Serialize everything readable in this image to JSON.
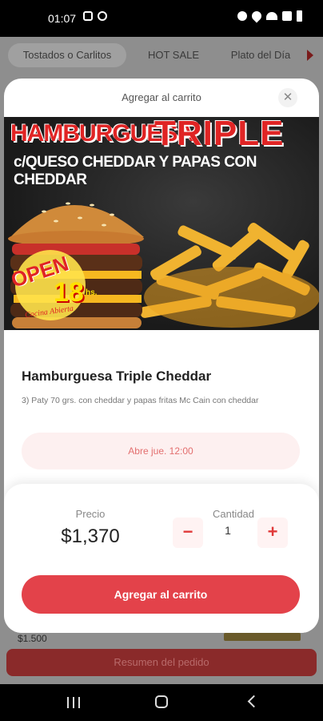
{
  "status_bar": {
    "time": "01:07",
    "left_icons": [
      "image-icon",
      "messenger-icon"
    ],
    "right_icons": [
      "alarm-icon",
      "location-icon",
      "wifi-icon",
      "signal-icon",
      "battery-icon"
    ]
  },
  "background_page": {
    "tabs": [
      {
        "label": "Tostados o Carlitos",
        "selected": true
      },
      {
        "label": "HOT SALE",
        "selected": false
      },
      {
        "label": "Plato del Día",
        "selected": false
      }
    ],
    "list_price": "$1.500",
    "summary_button": "Resumen del pedido"
  },
  "modal": {
    "title": "Agregar al carrito",
    "close_icon": "close-icon",
    "banner": {
      "line1_a": "HAMBURGUESA",
      "line1_b": "TRIPLE",
      "line2": "c/QUESO CHEDDAR Y PAPAS CON CHEDDAR",
      "badge_open": "OPEN",
      "badge_hours": "18",
      "badge_suffix": "hs.",
      "badge_sub": "Cocina Abierta"
    },
    "product": {
      "name": "Hamburguesa Triple Cheddar",
      "description": "3) Paty 70 grs. con cheddar y papas fritas Mc Cain con cheddar",
      "opens": "Abre jue. 12:00"
    },
    "order": {
      "price_label": "Precio",
      "price": "$1,370",
      "qty_label": "Cantidad",
      "qty": "1",
      "minus": "−",
      "plus": "+",
      "add_button": "Agregar al carrito"
    }
  },
  "colors": {
    "accent": "#e3424a",
    "accent_light": "#fdf0f0",
    "banner_red": "#e02424"
  }
}
